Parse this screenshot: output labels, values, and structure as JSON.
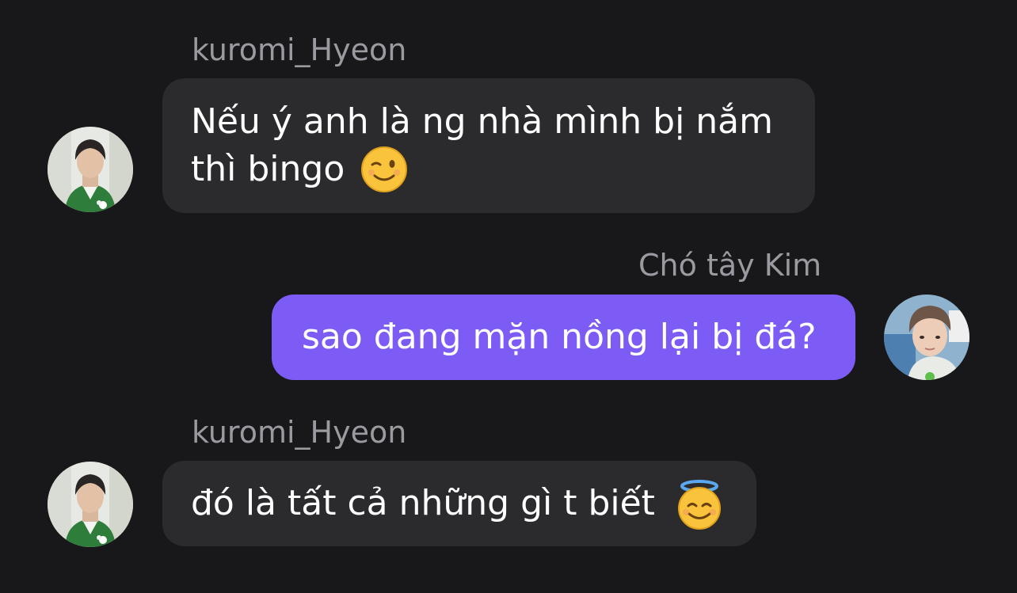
{
  "messages": [
    {
      "sender": "kuromi_Hyeon",
      "direction": "incoming",
      "text": "Nếu ý anh là ng nhà mình bị nắm thì bingo",
      "emoji": "winking-face"
    },
    {
      "sender": "Chó tây Kim",
      "direction": "outgoing",
      "text": "sao đang mặn nồng lại bị đá?"
    },
    {
      "sender": "kuromi_Hyeon",
      "direction": "incoming",
      "text": "đó là tất cả những gì t biết",
      "emoji": "smiling-face-with-halo"
    }
  ],
  "colors": {
    "background": "#18181a",
    "incoming_bubble": "#2b2b2e",
    "outgoing_bubble": "#7c5cf5",
    "sender_name": "#9a9aa0",
    "message_text": "#ffffff"
  }
}
